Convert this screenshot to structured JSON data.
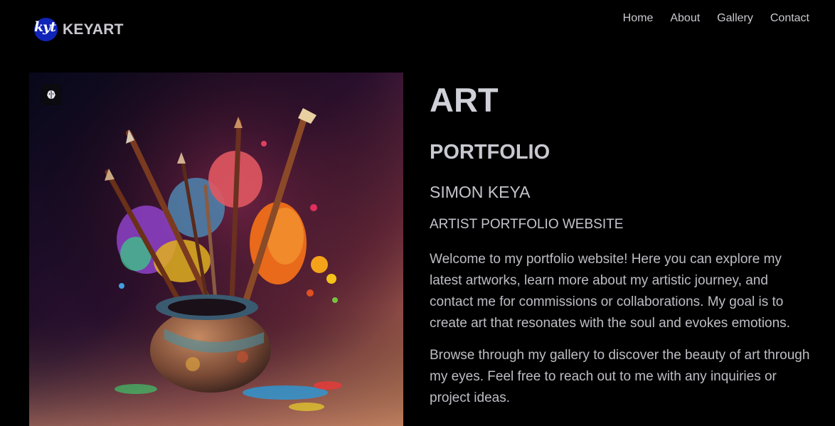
{
  "header": {
    "logo_text": "kyt",
    "brand_name": "KEYART",
    "nav": [
      "Home",
      "About",
      "Gallery",
      "Contact"
    ]
  },
  "hero": {
    "image_subject": "paint brushes in a clay pot with colorful paint splashes",
    "corner_icon": "brain-icon"
  },
  "content": {
    "title": "ART",
    "subtitle": "PORTFOLIO",
    "artist_name": "SIMON KEYA",
    "tagline": "ARTIST PORTFOLIO WEBSITE",
    "paragraph_1": "Welcome to my portfolio website! Here you can explore my latest artworks, learn more about my artistic journey, and contact me for commissions or collaborations. My goal is to create art that resonates with the soul and evokes emotions.",
    "paragraph_2": "Browse through my gallery to discover the beauty of art through my eyes. Feel free to reach out to me with any inquiries or project ideas."
  },
  "colors": {
    "background": "#000000",
    "logo_badge": "#1024b8",
    "text": "#c4c4cc"
  }
}
